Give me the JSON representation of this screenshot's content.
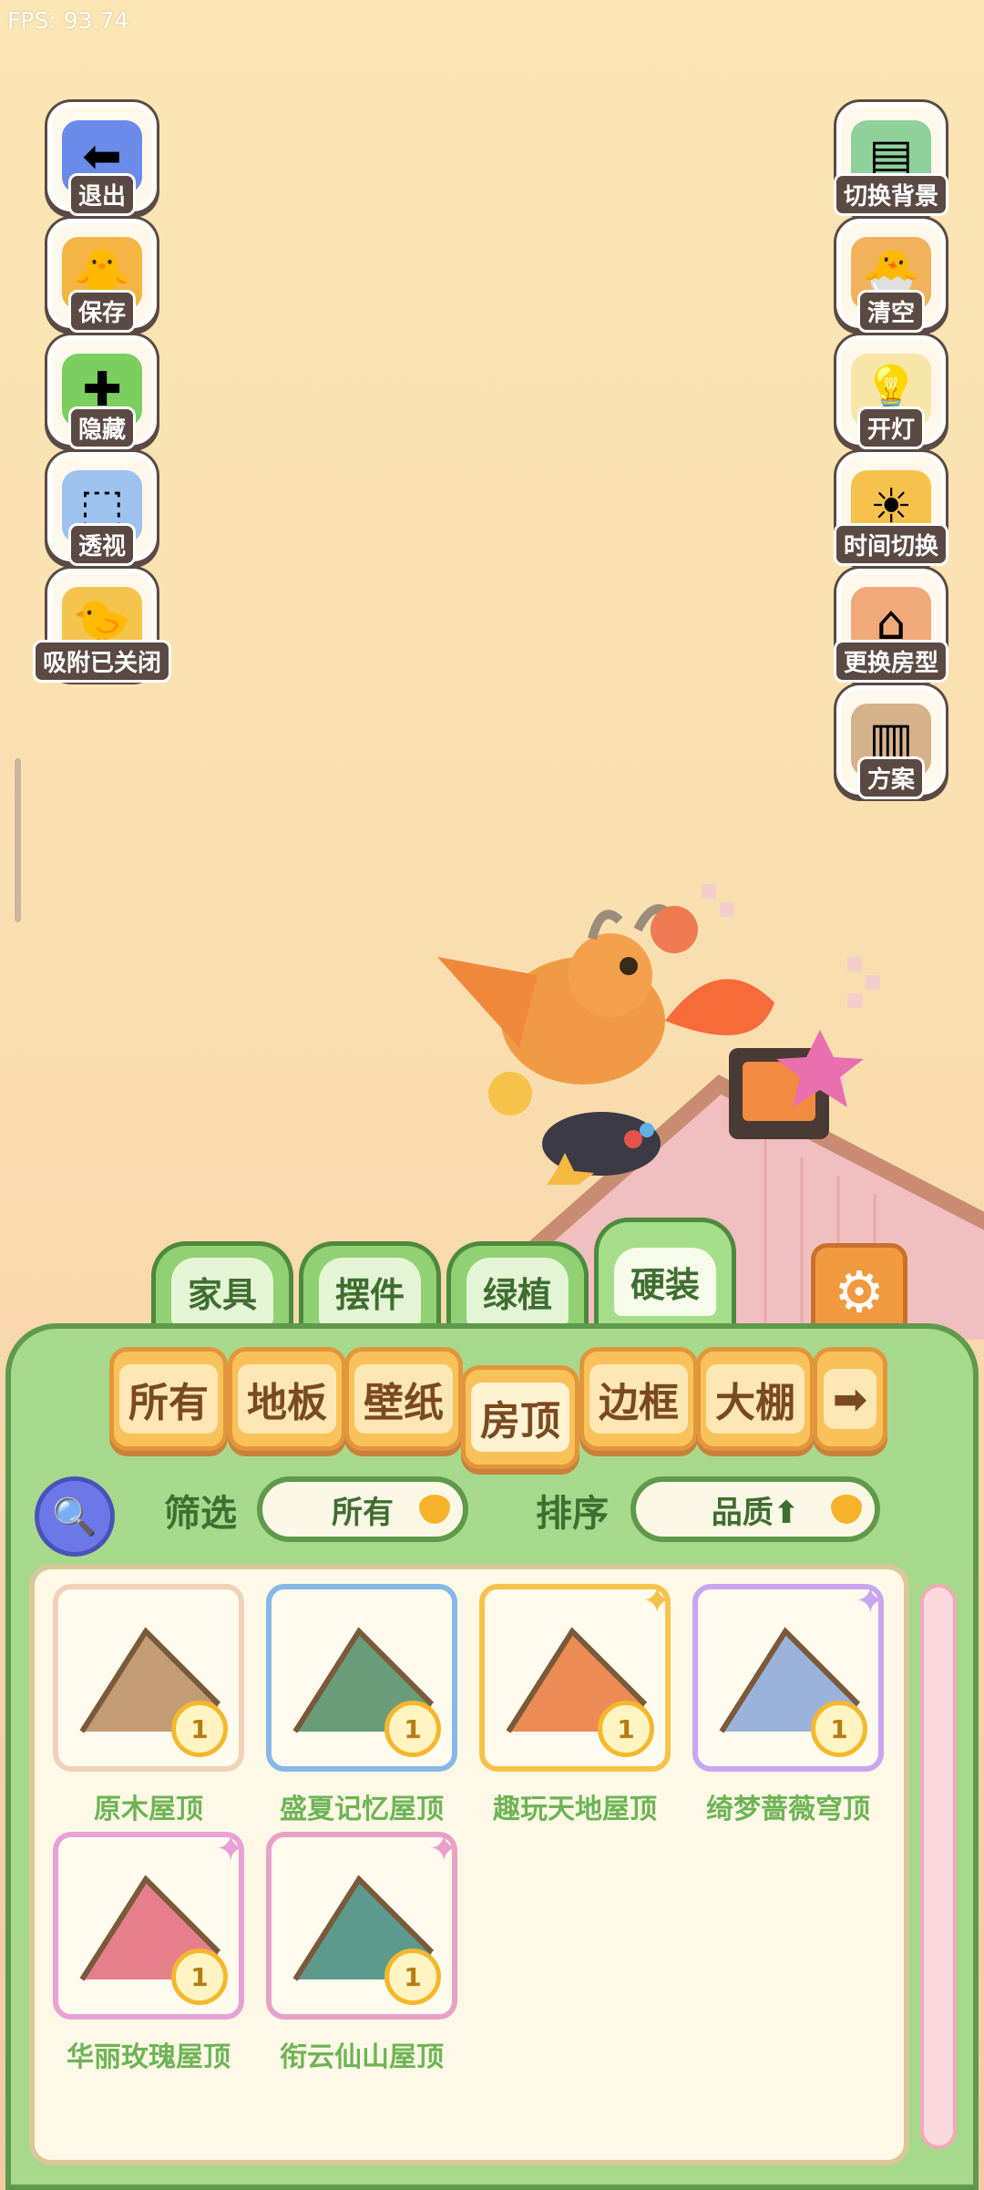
{
  "fps": "FPS: 93.74",
  "left_buttons": [
    {
      "label": "退出",
      "icon": "exit-arrow-icon",
      "color": "#6a8be8",
      "glyph": "⬅"
    },
    {
      "label": "保存",
      "icon": "chick-save-icon",
      "color": "#f4b545",
      "glyph": "🐥"
    },
    {
      "label": "隐藏",
      "icon": "hide-frame-icon",
      "color": "#7ccf5f",
      "glyph": "✚"
    },
    {
      "label": "透视",
      "icon": "perspective-cube-icon",
      "color": "#9ec2ee",
      "glyph": "⬚"
    },
    {
      "label": "吸附已关闭",
      "icon": "snap-chicks-icon",
      "color": "#f4c44c",
      "glyph": "🐤"
    }
  ],
  "right_buttons": [
    {
      "label": "切换背景",
      "icon": "background-scroll-icon",
      "color": "#8fd09b",
      "glyph": "▤"
    },
    {
      "label": "清空",
      "icon": "clear-chick-icon",
      "color": "#f1b25a",
      "glyph": "🐣"
    },
    {
      "label": "开灯",
      "icon": "lamp-icon",
      "color": "#f8e6a8",
      "glyph": "💡"
    },
    {
      "label": "时间切换",
      "icon": "sun-time-icon",
      "color": "#f7c24b",
      "glyph": "☀"
    },
    {
      "label": "更换房型",
      "icon": "house-icon",
      "color": "#f2a97a",
      "glyph": "⌂"
    },
    {
      "label": "方案",
      "icon": "plan-book-icon",
      "color": "#d6b28a",
      "glyph": "▥"
    }
  ],
  "top_tabs": [
    "家具",
    "摆件",
    "绿植",
    "硬装"
  ],
  "active_tab": "硬装",
  "categories": [
    "所有",
    "地板",
    "壁纸",
    "房顶",
    "边框",
    "大棚"
  ],
  "active_category": "房顶",
  "filter": {
    "label": "筛选",
    "value": "所有"
  },
  "sort": {
    "label": "排序",
    "value": "品质⬆"
  },
  "items": [
    {
      "name": "原木屋顶",
      "count": "1",
      "frame": "#f1d2b8",
      "color": "#b98a5e"
    },
    {
      "name": "盛夏记忆屋顶",
      "count": "1",
      "frame": "#86b8e8",
      "color": "#4f8c64"
    },
    {
      "name": "趣玩天地屋顶",
      "count": "1",
      "frame": "#f7c24b",
      "color": "#e7783a"
    },
    {
      "name": "绮梦蔷薇穹顶",
      "count": "1",
      "frame": "#c9a6f1",
      "color": "#8aa6d6"
    },
    {
      "name": "华丽玫瑰屋顶",
      "count": "1",
      "frame": "#e8a2d8",
      "color": "#e0687a"
    },
    {
      "name": "衔云仙山屋顶",
      "count": "1",
      "frame": "#e8a2c8",
      "color": "#3f8a7a"
    }
  ]
}
